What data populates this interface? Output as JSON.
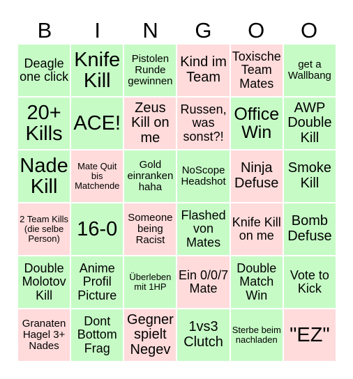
{
  "header": {
    "letters": [
      "B",
      "I",
      "N",
      "G",
      "O",
      "O"
    ]
  },
  "colors": {
    "green": "#c6fbc6",
    "red": "#ffdbdb"
  },
  "cells": [
    {
      "text": "Deagle one click",
      "color": "green"
    },
    {
      "text": "Knife Kill",
      "color": "green"
    },
    {
      "text": "Pistolen Runde gewinnen",
      "color": "green"
    },
    {
      "text": "Kind im Team",
      "color": "red"
    },
    {
      "text": "Toxische Team Mates",
      "color": "red"
    },
    {
      "text": "get a Wallbang",
      "color": "green"
    },
    {
      "text": "20+ Kills",
      "color": "green"
    },
    {
      "text": "ACE!",
      "color": "green"
    },
    {
      "text": "Zeus Kill on me",
      "color": "red"
    },
    {
      "text": "Russen, was sonst?!",
      "color": "red"
    },
    {
      "text": "Office Win",
      "color": "green"
    },
    {
      "text": "AWP Double Kill",
      "color": "green"
    },
    {
      "text": "Nade Kill",
      "color": "green"
    },
    {
      "text": "Mate Quit bis Matchende",
      "color": "red"
    },
    {
      "text": "Gold einranken haha",
      "color": "green"
    },
    {
      "text": "NoScope Headshot",
      "color": "green"
    },
    {
      "text": "Ninja Defuse",
      "color": "red"
    },
    {
      "text": "Smoke Kill",
      "color": "green"
    },
    {
      "text": "2 Team Kills (die selbe Person)",
      "color": "red"
    },
    {
      "text": "16-0",
      "color": "green"
    },
    {
      "text": "Someone being Racist",
      "color": "red"
    },
    {
      "text": "Flashed von Mates",
      "color": "green"
    },
    {
      "text": "Knife Kill on me",
      "color": "red"
    },
    {
      "text": "Bomb Defuse",
      "color": "green"
    },
    {
      "text": "Double Molotov Kill",
      "color": "green"
    },
    {
      "text": "Anime Profil Picture",
      "color": "green"
    },
    {
      "text": "Überleben mit 1HP",
      "color": "green"
    },
    {
      "text": "Ein 0/0/7 Mate",
      "color": "red"
    },
    {
      "text": "Double Match Win",
      "color": "green"
    },
    {
      "text": "Vote to Kick",
      "color": "green"
    },
    {
      "text": "Granaten Hagel 3+ Nades",
      "color": "red"
    },
    {
      "text": "Dont Bottom Frag",
      "color": "green"
    },
    {
      "text": "Gegner spielt Negev",
      "color": "red"
    },
    {
      "text": "1vs3 Clutch",
      "color": "green"
    },
    {
      "text": "Sterbe beim nachladen",
      "color": "green"
    },
    {
      "text": "\"EZ\"",
      "color": "red"
    }
  ]
}
